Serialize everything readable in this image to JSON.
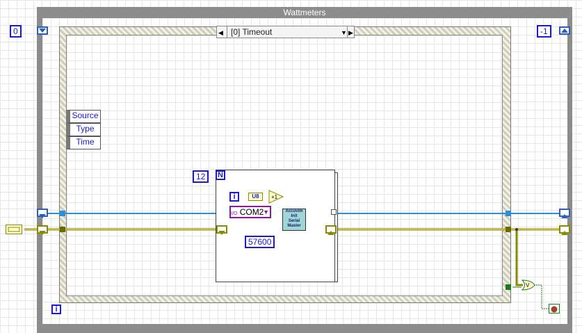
{
  "while_loop": {
    "title": "Wattmeters",
    "iteration": "i"
  },
  "left_constant": "0",
  "right_constant": "-1",
  "case_selector": {
    "label": "[0] Timeout"
  },
  "cluster": {
    "items": [
      "Source",
      "Type",
      "Time"
    ]
  },
  "for_loop": {
    "count": "12",
    "count_terminal": "N",
    "iteration": "i"
  },
  "convert_label": "U8",
  "increment_label": "+1",
  "resource": {
    "prefix": "I/O",
    "value": "COM2"
  },
  "subvi": {
    "lines": [
      "Accuvim",
      "Init",
      "Serial",
      "Master"
    ]
  },
  "baud_constant": "57600",
  "or_label": "V",
  "colors": {
    "wire_blue": "#2a8fd6",
    "wire_error": "#8a8a00",
    "const_blue": "#1a1ad0",
    "resource_purple": "#8a1a9a",
    "stop_green": "#1f7a1f",
    "stop_red": "#d42a2a"
  }
}
